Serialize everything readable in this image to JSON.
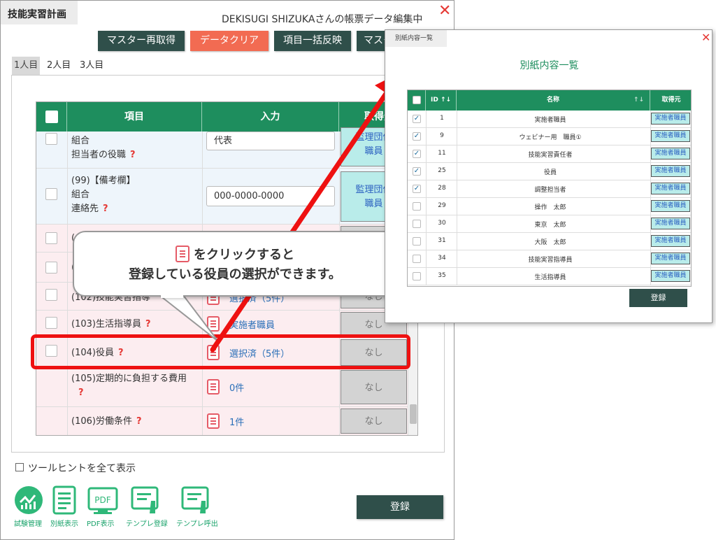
{
  "window": {
    "title": "技能実習計画",
    "status": "DEKISUGI SHIZUKAさんの帳票データ編集中",
    "close_icon": "✕"
  },
  "toolbar": {
    "buttons": [
      "マスター再取得",
      "データクリア",
      "項目一括反映",
      "マスター"
    ]
  },
  "person_tabs": [
    "1人目",
    "2人目",
    "3人目"
  ],
  "table": {
    "headers": [
      "項目",
      "入力",
      "取得元"
    ],
    "rows": [
      {
        "label1": "組合",
        "label2": "担当者の役職",
        "q": "?",
        "input": "代表",
        "source1": "監理団体",
        "source2": "職員"
      },
      {
        "label0": "(99)【備考欄】",
        "label1": "組合",
        "label2": "連絡先",
        "q": "?",
        "input": "000-0000-0000",
        "source1": "監理団体",
        "source2": "職員"
      },
      {
        "label1": "(",
        "link": "",
        "source": ""
      },
      {
        "label1": "(",
        "link": "",
        "source": ""
      },
      {
        "label1": "(102)技能実習指導",
        "link": "選択済（5件）",
        "source": "なし"
      },
      {
        "label1": "(103)生活指導員",
        "q": "?",
        "link": "実施者職員",
        "source": "なし"
      },
      {
        "label1": "(104)役員",
        "q": "?",
        "link": "選択済（5件）",
        "source": "なし"
      },
      {
        "label1": "(105)定期的に負担する費用",
        "q": "?",
        "link": "0件",
        "source": "なし"
      },
      {
        "label1": "(106)労働条件",
        "q": "?",
        "link": "1件",
        "source": "なし"
      }
    ]
  },
  "tooltip_hint": {
    "label": "ツールヒントを全て表示"
  },
  "bottom_icons": [
    {
      "label": "試験管理",
      "icon": "chart-icon"
    },
    {
      "label": "別紙表示",
      "icon": "document-icon"
    },
    {
      "label": "PDF表示",
      "icon": "pdf-icon",
      "badge": "PDF"
    },
    {
      "label": "テンプレ登録",
      "icon": "template-save-icon"
    },
    {
      "label": "テンプレ呼出",
      "icon": "template-load-icon"
    }
  ],
  "register_button": "登録",
  "callout": {
    "line1": "をクリックすると",
    "line2": "登録している役員の選択ができます。"
  },
  "modal": {
    "tab": "別紙内容一覧",
    "heading": "別紙内容一覧",
    "close_icon": "✕",
    "headers": {
      "id": "ID",
      "name": "名称",
      "source": "取得元"
    },
    "rows": [
      {
        "checked": true,
        "id": "1",
        "name": "実施者職員",
        "source": "実施者職員"
      },
      {
        "checked": true,
        "id": "9",
        "name": "ウェビナー用　職員①",
        "source": "実施者職員"
      },
      {
        "checked": true,
        "id": "11",
        "name": "技能実習責任者",
        "source": "実施者職員"
      },
      {
        "checked": true,
        "id": "25",
        "name": "役員",
        "source": "実施者職員"
      },
      {
        "checked": true,
        "id": "28",
        "name": "調整担当者",
        "source": "実施者職員"
      },
      {
        "checked": false,
        "id": "29",
        "name": "操作　太郎",
        "source": "実施者職員"
      },
      {
        "checked": false,
        "id": "30",
        "name": "東京　太郎",
        "source": "実施者職員"
      },
      {
        "checked": false,
        "id": "31",
        "name": "大阪　太郎",
        "source": "実施者職員"
      },
      {
        "checked": false,
        "id": "34",
        "name": "技能実習指導員",
        "source": "実施者職員"
      },
      {
        "checked": false,
        "id": "35",
        "name": "生活指導員",
        "source": "実施者職員"
      }
    ],
    "register": "登録"
  },
  "colors": {
    "header_green": "#1e8e5e",
    "dark_button": "#2f4f4a",
    "clear_button": "#f26b52",
    "highlight": "#ee1111",
    "close_red": "#e53935"
  }
}
